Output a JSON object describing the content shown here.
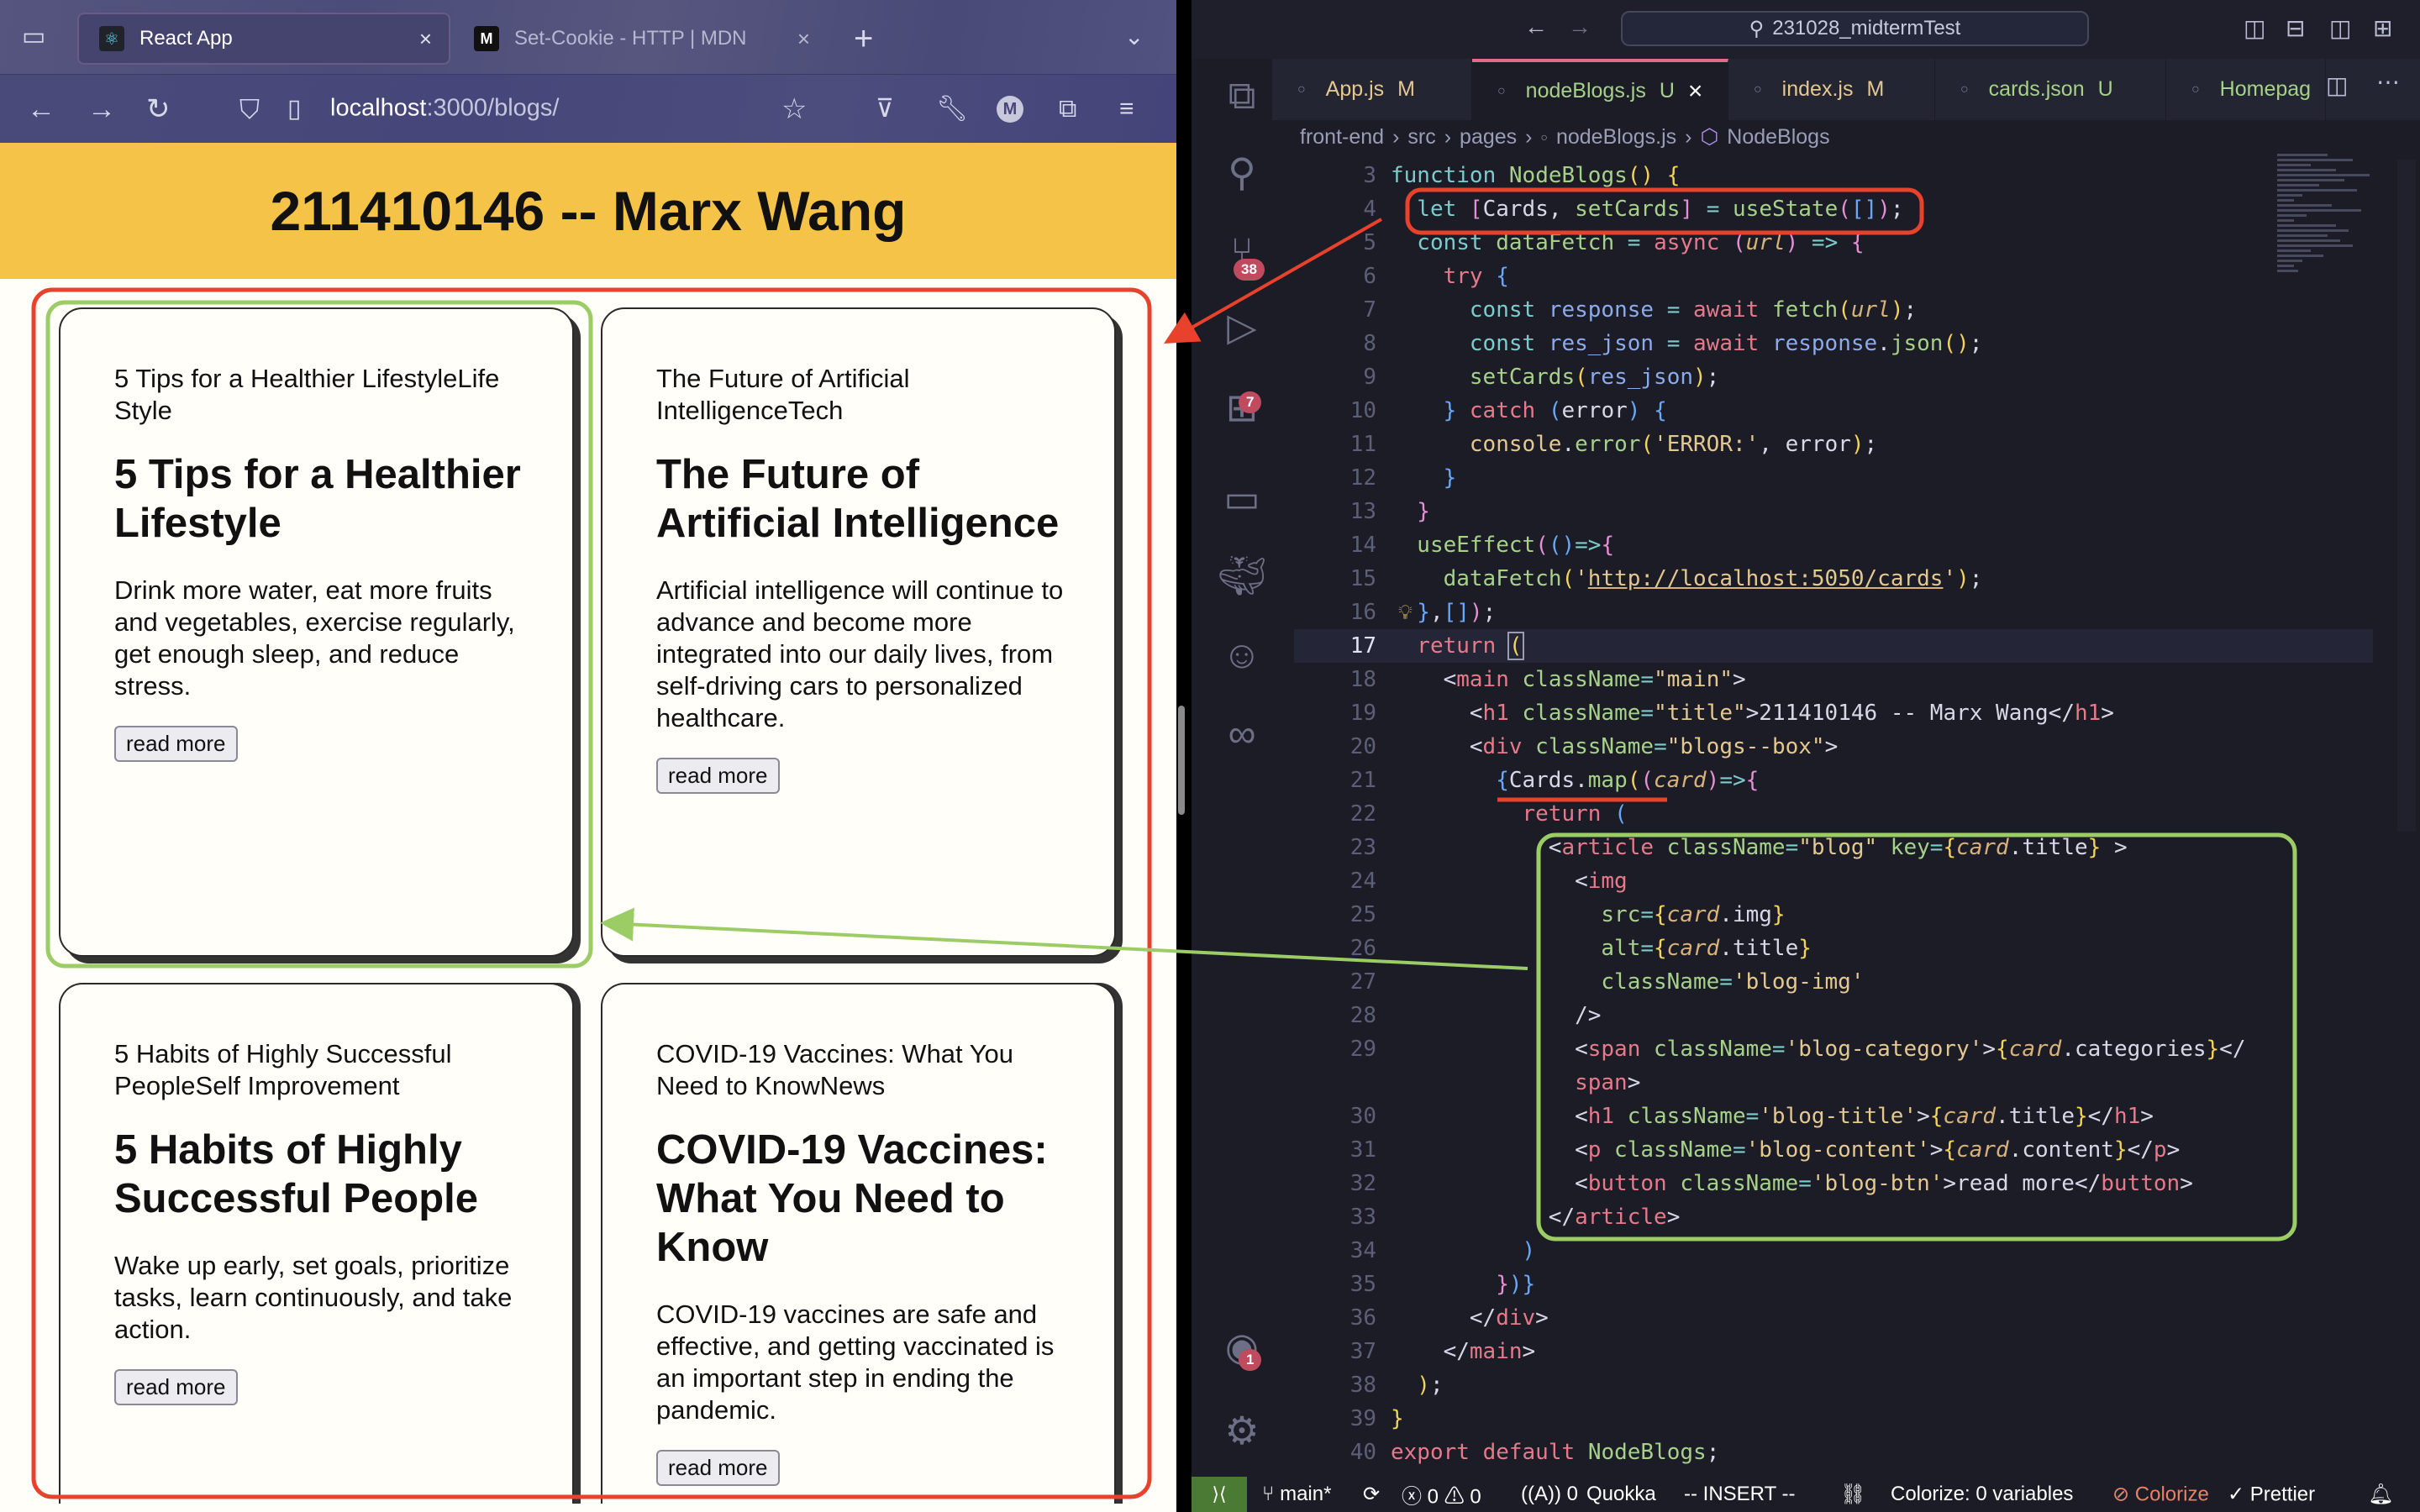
{
  "browser": {
    "tabs": [
      {
        "label": "React App",
        "icon": "react-icon",
        "active": true
      },
      {
        "label": "Set-Cookie - HTTP | MDN",
        "icon": "mdn-icon",
        "active": false
      }
    ],
    "url_host": "localhost",
    "url_rest": ":3000/blogs/",
    "page_title": "211410146 -- Marx Wang",
    "cards": [
      {
        "category": "5 Tips for a Healthier LifestyleLife Style",
        "title": "5 Tips for a Healthier Lifestyle",
        "content": "Drink more water, eat more fruits and vegetables, exercise regularly, get enough sleep, and reduce stress.",
        "button": "read more"
      },
      {
        "category": "The Future of Artificial IntelligenceTech",
        "title": "The Future of Artificial Intelligence",
        "content": "Artificial intelligence will continue to advance and become more integrated into our daily lives, from self-driving cars to personalized healthcare.",
        "button": "read more"
      },
      {
        "category": "5 Habits of Highly Successful PeopleSelf Improvement",
        "title": "5 Habits of Highly Successful People",
        "content": "Wake up early, set goals, prioritize tasks, learn continuously, and take action.",
        "button": "read more"
      },
      {
        "category": "COVID-19 Vaccines: What You Need to KnowNews",
        "title": "COVID-19 Vaccines: What You Need to Know",
        "content": "COVID-19 vaccines are safe and effective, and getting vaccinated is an important step in ending the pandemic.",
        "button": "read more"
      }
    ]
  },
  "editor": {
    "search": "231028_midtermTest",
    "tabs": [
      {
        "name": "App.js",
        "status": "M",
        "color": "#e5c890"
      },
      {
        "name": "nodeBlogs.js",
        "status": "U",
        "color": "#a6d189",
        "active": true
      },
      {
        "name": "index.js",
        "status": "M",
        "color": "#e5c890"
      },
      {
        "name": "cards.json",
        "status": "U",
        "color": "#a6d189"
      },
      {
        "name": "Homepag",
        "status": "",
        "color": "#a6d189"
      }
    ],
    "breadcrumb": [
      "front-end",
      "src",
      "pages",
      "nodeBlogs.js",
      "NodeBlogs"
    ],
    "badges": {
      "source_control": "38",
      "extensions": "7",
      "accounts": "1"
    },
    "current_line": 17,
    "lines": [
      {
        "n": "3",
        "ind": 0,
        "tk": [
          [
            "k",
            "function "
          ],
          [
            "f",
            "NodeBlogs"
          ],
          [
            "y",
            "()"
          ],
          [
            "p",
            " "
          ],
          [
            "y",
            "{"
          ]
        ]
      },
      {
        "n": "4",
        "ind": 1,
        "tk": [
          [
            "k",
            "let "
          ],
          [
            "pk",
            "["
          ],
          [
            "p",
            "Cards, "
          ],
          [
            "f",
            "setCards"
          ],
          [
            "pk",
            "]"
          ],
          [
            "o",
            " = "
          ],
          [
            "f",
            "useState"
          ],
          [
            "pk",
            "("
          ],
          [
            "b",
            "[]"
          ],
          [
            "pk",
            ")"
          ],
          [
            "p",
            ";"
          ]
        ]
      },
      {
        "n": "5",
        "ind": 1,
        "tk": [
          [
            "k",
            "const "
          ],
          [
            "f",
            "dataFetch"
          ],
          [
            "o",
            " = "
          ],
          [
            "r",
            "async "
          ],
          [
            "pk",
            "("
          ],
          [
            "i",
            "url"
          ],
          [
            "pk",
            ")"
          ],
          [
            "o",
            " => "
          ],
          [
            "pk",
            "{"
          ]
        ]
      },
      {
        "n": "6",
        "ind": 2,
        "tk": [
          [
            "r",
            "try "
          ],
          [
            "b",
            "{"
          ]
        ]
      },
      {
        "n": "7",
        "ind": 3,
        "tk": [
          [
            "k",
            "const "
          ],
          [
            "v",
            "response"
          ],
          [
            "o",
            " = "
          ],
          [
            "r",
            "await "
          ],
          [
            "f",
            "fetch"
          ],
          [
            "y",
            "("
          ],
          [
            "i",
            "url"
          ],
          [
            "y",
            ")"
          ],
          [
            "p",
            ";"
          ]
        ]
      },
      {
        "n": "8",
        "ind": 3,
        "tk": [
          [
            "k",
            "const "
          ],
          [
            "v",
            "res_json"
          ],
          [
            "o",
            " = "
          ],
          [
            "r",
            "await "
          ],
          [
            "v",
            "response"
          ],
          [
            "p",
            "."
          ],
          [
            "f",
            "json"
          ],
          [
            "y",
            "()"
          ],
          [
            "p",
            ";"
          ]
        ]
      },
      {
        "n": "9",
        "ind": 3,
        "tk": [
          [
            "f",
            "setCards"
          ],
          [
            "y",
            "("
          ],
          [
            "v",
            "res_json"
          ],
          [
            "y",
            ")"
          ],
          [
            "p",
            ";"
          ]
        ]
      },
      {
        "n": "10",
        "ind": 2,
        "tk": [
          [
            "b",
            "} "
          ],
          [
            "r",
            "catch "
          ],
          [
            "b",
            "("
          ],
          [
            "p",
            "error"
          ],
          [
            "b",
            ")"
          ],
          [
            "p",
            " "
          ],
          [
            "b",
            "{"
          ]
        ]
      },
      {
        "n": "11",
        "ind": 3,
        "tk": [
          [
            "s",
            "console"
          ],
          [
            "p",
            "."
          ],
          [
            "f",
            "error"
          ],
          [
            "y",
            "("
          ],
          [
            "s",
            "'ERROR:'"
          ],
          [
            "p",
            ", error"
          ],
          [
            "y",
            ")"
          ],
          [
            "p",
            ";"
          ]
        ]
      },
      {
        "n": "12",
        "ind": 2,
        "tk": [
          [
            "b",
            "}"
          ]
        ]
      },
      {
        "n": "13",
        "ind": 1,
        "tk": [
          [
            "pk",
            "}"
          ]
        ]
      },
      {
        "n": "14",
        "ind": 1,
        "tk": [
          [
            "f",
            "useEffect"
          ],
          [
            "pk",
            "("
          ],
          [
            "b",
            "()"
          ],
          [
            "o",
            "=>"
          ],
          [
            "pk",
            "{"
          ]
        ]
      },
      {
        "n": "15",
        "ind": 2,
        "tk": [
          [
            "f",
            "dataFetch"
          ],
          [
            "y",
            "("
          ],
          [
            "s",
            "'"
          ],
          [
            "su",
            "http://localhost:5050/cards"
          ],
          [
            "s",
            "'"
          ],
          [
            "y",
            ")"
          ],
          [
            "p",
            ";"
          ]
        ]
      },
      {
        "n": "16",
        "ind": 1,
        "tk": [
          [
            "b",
            "}"
          ],
          [
            "p",
            ","
          ],
          [
            "b",
            "[]"
          ],
          [
            "pk",
            ")"
          ],
          [
            "p",
            ";"
          ]
        ]
      },
      {
        "n": "17",
        "ind": 1,
        "tk": [
          [
            "r",
            "return "
          ],
          [
            "y",
            "("
          ]
        ]
      },
      {
        "n": "18",
        "ind": 2,
        "tk": [
          [
            "p",
            "<"
          ],
          [
            "t",
            "main"
          ],
          [
            "a",
            " className"
          ],
          [
            "o",
            "="
          ],
          [
            "s",
            "\"main\""
          ],
          [
            "p",
            ">"
          ]
        ]
      },
      {
        "n": "19",
        "ind": 3,
        "tk": [
          [
            "p",
            "<"
          ],
          [
            "t",
            "h1"
          ],
          [
            "a",
            " className"
          ],
          [
            "o",
            "="
          ],
          [
            "s",
            "\"title\""
          ],
          [
            "p",
            ">211410146 -- Marx Wang</"
          ],
          [
            "t",
            "h1"
          ],
          [
            "p",
            ">"
          ]
        ]
      },
      {
        "n": "20",
        "ind": 3,
        "tk": [
          [
            "p",
            "<"
          ],
          [
            "t",
            "div"
          ],
          [
            "a",
            " className"
          ],
          [
            "o",
            "="
          ],
          [
            "s",
            "\"blogs--box\""
          ],
          [
            "p",
            ">"
          ]
        ]
      },
      {
        "n": "21",
        "ind": 4,
        "tk": [
          [
            "b",
            "{"
          ],
          [
            "p",
            "Cards."
          ],
          [
            "f",
            "map"
          ],
          [
            "y",
            "("
          ],
          [
            "pk",
            "("
          ],
          [
            "i",
            "card"
          ],
          [
            "pk",
            ")"
          ],
          [
            "o",
            "=>"
          ],
          [
            "pk",
            "{"
          ]
        ]
      },
      {
        "n": "22",
        "ind": 5,
        "tk": [
          [
            "r",
            "return "
          ],
          [
            "b",
            "("
          ]
        ]
      },
      {
        "n": "23",
        "ind": 6,
        "tk": [
          [
            "p",
            "<"
          ],
          [
            "t",
            "article"
          ],
          [
            "a",
            " className"
          ],
          [
            "o",
            "="
          ],
          [
            "s",
            "\"blog\""
          ],
          [
            "a",
            " key"
          ],
          [
            "o",
            "="
          ],
          [
            "y",
            "{"
          ],
          [
            "i",
            "card"
          ],
          [
            "p",
            ".title"
          ],
          [
            "y",
            "}"
          ],
          [
            "p",
            " >"
          ]
        ]
      },
      {
        "n": "24",
        "ind": 7,
        "tk": [
          [
            "p",
            "<"
          ],
          [
            "t",
            "img"
          ]
        ]
      },
      {
        "n": "25",
        "ind": 8,
        "tk": [
          [
            "a",
            "src"
          ],
          [
            "o",
            "="
          ],
          [
            "y",
            "{"
          ],
          [
            "i",
            "card"
          ],
          [
            "p",
            ".img"
          ],
          [
            "y",
            "}"
          ]
        ]
      },
      {
        "n": "26",
        "ind": 8,
        "tk": [
          [
            "a",
            "alt"
          ],
          [
            "o",
            "="
          ],
          [
            "y",
            "{"
          ],
          [
            "i",
            "card"
          ],
          [
            "p",
            ".title"
          ],
          [
            "y",
            "}"
          ]
        ]
      },
      {
        "n": "27",
        "ind": 8,
        "tk": [
          [
            "a",
            "className"
          ],
          [
            "o",
            "="
          ],
          [
            "s",
            "'blog-img'"
          ]
        ]
      },
      {
        "n": "28",
        "ind": 7,
        "tk": [
          [
            "p",
            "/>"
          ]
        ]
      },
      {
        "n": "29",
        "ind": 7,
        "tk": [
          [
            "p",
            "<"
          ],
          [
            "t",
            "span"
          ],
          [
            "a",
            " className"
          ],
          [
            "o",
            "="
          ],
          [
            "s",
            "'blog-category'"
          ],
          [
            "p",
            ">"
          ],
          [
            "y",
            "{"
          ],
          [
            "i",
            "card"
          ],
          [
            "p",
            ".categories"
          ],
          [
            "y",
            "}"
          ],
          [
            "p",
            "</"
          ]
        ]
      },
      {
        "n": "",
        "ind": 7,
        "tk": [
          [
            "t",
            "span"
          ],
          [
            "p",
            ">"
          ]
        ]
      },
      {
        "n": "30",
        "ind": 7,
        "tk": [
          [
            "p",
            "<"
          ],
          [
            "t",
            "h1"
          ],
          [
            "a",
            " className"
          ],
          [
            "o",
            "="
          ],
          [
            "s",
            "'blog-title'"
          ],
          [
            "p",
            ">"
          ],
          [
            "y",
            "{"
          ],
          [
            "i",
            "card"
          ],
          [
            "p",
            ".title"
          ],
          [
            "y",
            "}"
          ],
          [
            "p",
            "</"
          ],
          [
            "t",
            "h1"
          ],
          [
            "p",
            ">"
          ]
        ]
      },
      {
        "n": "31",
        "ind": 7,
        "tk": [
          [
            "p",
            "<"
          ],
          [
            "t",
            "p"
          ],
          [
            "a",
            " className"
          ],
          [
            "o",
            "="
          ],
          [
            "s",
            "'blog-content'"
          ],
          [
            "p",
            ">"
          ],
          [
            "y",
            "{"
          ],
          [
            "i",
            "card"
          ],
          [
            "p",
            ".content"
          ],
          [
            "y",
            "}"
          ],
          [
            "p",
            "</"
          ],
          [
            "t",
            "p"
          ],
          [
            "p",
            ">"
          ]
        ]
      },
      {
        "n": "32",
        "ind": 7,
        "tk": [
          [
            "p",
            "<"
          ],
          [
            "t",
            "button"
          ],
          [
            "a",
            " className"
          ],
          [
            "o",
            "="
          ],
          [
            "s",
            "'blog-btn'"
          ],
          [
            "p",
            ">read more</"
          ],
          [
            "t",
            "button"
          ],
          [
            "p",
            ">"
          ]
        ]
      },
      {
        "n": "33",
        "ind": 6,
        "tk": [
          [
            "p",
            "</"
          ],
          [
            "t",
            "article"
          ],
          [
            "p",
            ">"
          ]
        ]
      },
      {
        "n": "34",
        "ind": 5,
        "tk": [
          [
            "b",
            ")"
          ]
        ]
      },
      {
        "n": "35",
        "ind": 4,
        "tk": [
          [
            "pk",
            "}"
          ],
          [
            "b",
            ")"
          ],
          [
            "b",
            "}"
          ]
        ]
      },
      {
        "n": "36",
        "ind": 3,
        "tk": [
          [
            "p",
            "</"
          ],
          [
            "t",
            "div"
          ],
          [
            "p",
            ">"
          ]
        ]
      },
      {
        "n": "37",
        "ind": 2,
        "tk": [
          [
            "p",
            "</"
          ],
          [
            "t",
            "main"
          ],
          [
            "p",
            ">"
          ]
        ]
      },
      {
        "n": "38",
        "ind": 1,
        "tk": [
          [
            "y",
            ")"
          ],
          [
            "p",
            ";"
          ]
        ]
      },
      {
        "n": "39",
        "ind": 0,
        "tk": [
          [
            "y",
            "}"
          ]
        ]
      },
      {
        "n": "40",
        "ind": 0,
        "tk": [
          [
            "r",
            "export default "
          ],
          [
            "f",
            "NodeBlogs"
          ],
          [
            "p",
            ";"
          ]
        ]
      }
    ],
    "status": {
      "branch": "main*",
      "errors": "0",
      "warnings": "0",
      "ports": "0",
      "quokka": "Quokka",
      "mode": "-- INSERT --",
      "colorize_vars": "Colorize: 0 variables",
      "colorize": "Colorize",
      "prettier": "Prettier"
    }
  },
  "annotations": {
    "red": "#e8412c",
    "green": "#9ccc65"
  }
}
